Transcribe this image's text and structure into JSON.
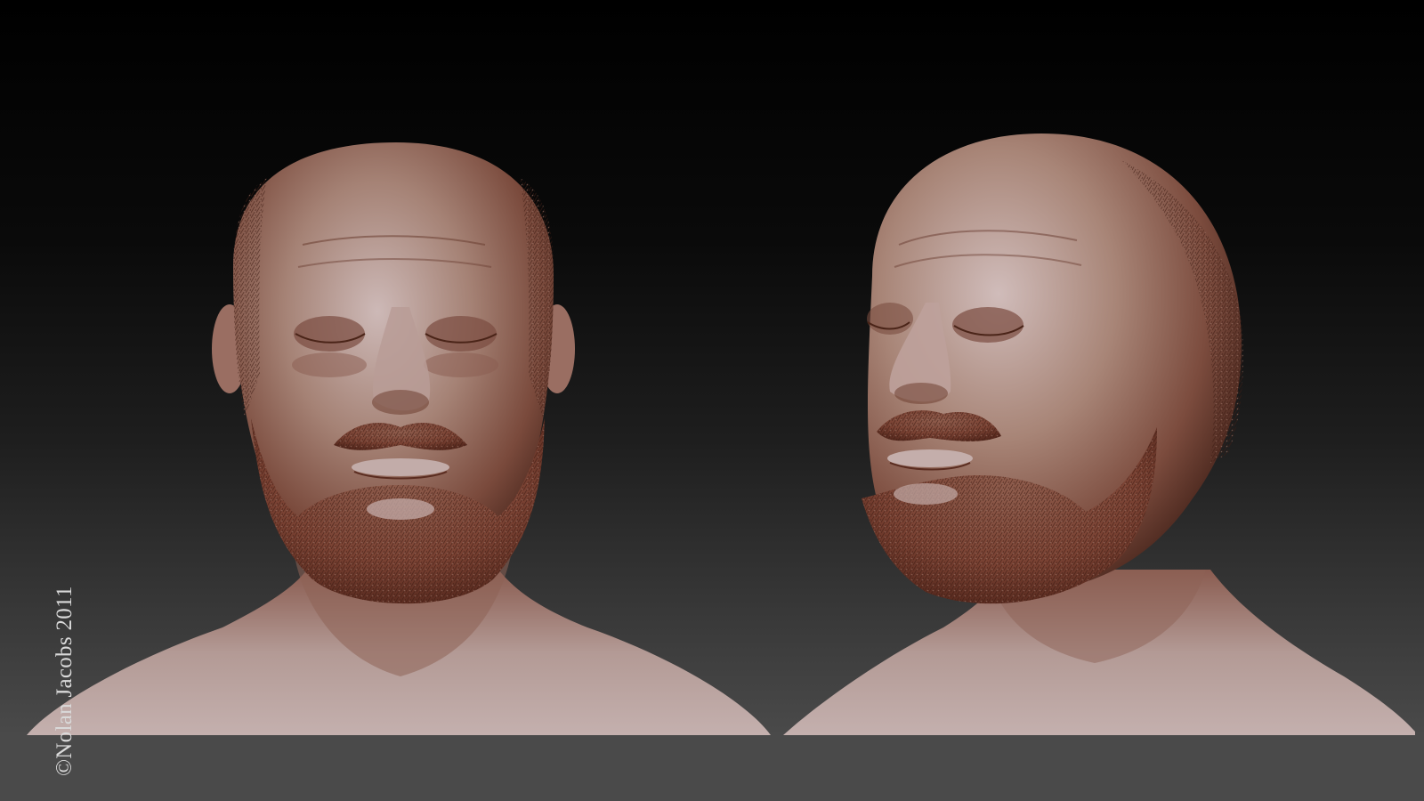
{
  "canvas": {
    "background_top": "#000000",
    "background_bottom": "#4c4c4c",
    "ground_color": "#4a4a4a"
  },
  "render": {
    "material_color": "#8a5a4c",
    "material_highlight": "#c9b5b3",
    "material_shadow": "#4e2a20",
    "views": [
      {
        "view": "front",
        "subject": "bald bearded man bust"
      },
      {
        "view": "three-quarter",
        "subject": "bald bearded man bust"
      }
    ]
  },
  "credit": {
    "text": "©Nolan Jacobs 2011"
  }
}
